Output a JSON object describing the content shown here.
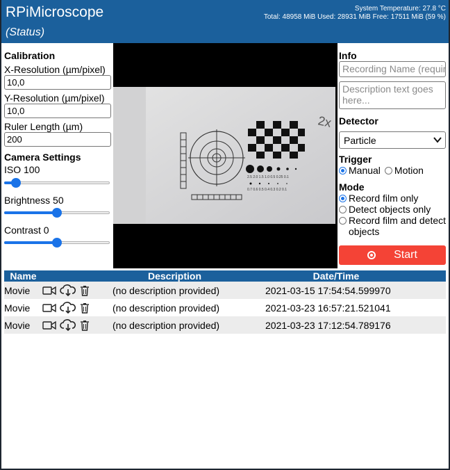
{
  "header": {
    "app_title": "RPiMicroscope",
    "status": "(Status)",
    "temperature": "System Temperature: 27.8 °C",
    "memory": "Total: 48958 MiB Used: 28931 MiB Free: 17511 MiB (59 %)"
  },
  "calibration": {
    "title": "Calibration",
    "x_label": "X-Resolution (µm/pixel)",
    "x_value": "10,0",
    "y_label": "Y-Resolution (µm/pixel)",
    "y_value": "10,0",
    "ruler_label": "Ruler Length (µm)",
    "ruler_value": "200"
  },
  "camera_settings": {
    "title": "Camera Settings",
    "iso_label": "ISO 100",
    "iso_level": 0.11,
    "brightness_label": "Brightness 50",
    "brightness_level": 0.5,
    "contrast_label": "Contrast 0",
    "contrast_level": 0.5
  },
  "info": {
    "title": "Info",
    "name_placeholder": "Recording Name (required)",
    "description_placeholder": "Description text goes here..."
  },
  "detector": {
    "title": "Detector",
    "selected": "Particle"
  },
  "trigger": {
    "title": "Trigger",
    "manual": "Manual",
    "motion": "Motion",
    "selected": "manual"
  },
  "mode": {
    "title": "Mode",
    "record_only": "Record film only",
    "detect_only": "Detect objects only",
    "record_and_detect": "Record film and detect objects",
    "selected": "record_only"
  },
  "start_label": "Start",
  "table": {
    "headers": {
      "name": "Name",
      "description": "Description",
      "datetime": "Date/Time"
    },
    "rows": [
      {
        "name": "Movie",
        "description": "(no description provided)",
        "datetime": "2021-03-15 17:54:54.599970"
      },
      {
        "name": "Movie",
        "description": "(no description provided)",
        "datetime": "2021-03-23 16:57:21.521041"
      },
      {
        "name": "Movie",
        "description": "(no description provided)",
        "datetime": "2021-03-23 17:12:54.789176"
      }
    ]
  },
  "colors": {
    "header_bg": "#1b609c",
    "accent": "#1a73e8",
    "start_button": "#f44336"
  }
}
